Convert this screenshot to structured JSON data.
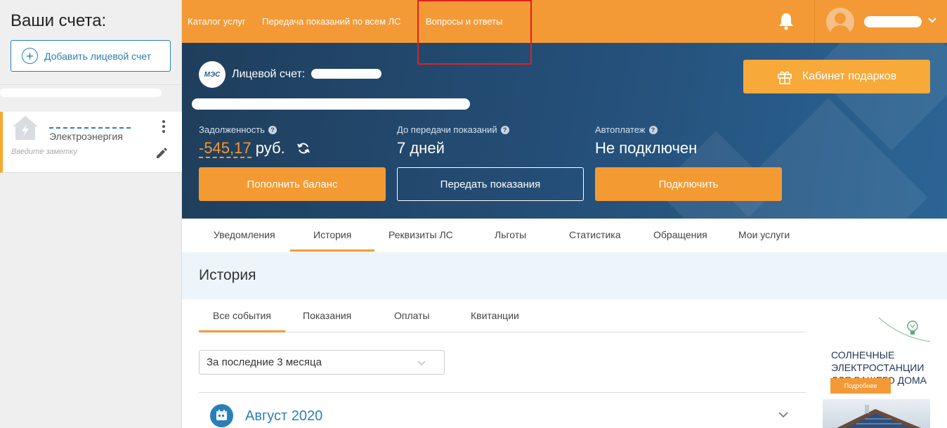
{
  "sidebar": {
    "title": "Ваши счета:",
    "add_account_label": "Добавить лицевой счет",
    "account": {
      "type": "Электроэнергия",
      "note_placeholder": "Введите заметку"
    }
  },
  "nav": {
    "links": [
      "Каталог услуг",
      "Передача показаний по всем ЛС",
      "Вопросы и ответы"
    ]
  },
  "hero": {
    "logo_text": "МЭС",
    "account_label": "Лицевой счет:",
    "gift_button": "Кабинет подарков",
    "debt": {
      "label": "Задолженность",
      "value": "-545,17",
      "unit": "руб."
    },
    "readings": {
      "label": "До передачи показаний",
      "value": "7 дней"
    },
    "autopay": {
      "label": "Автоплатеж",
      "value": "Не подключен"
    },
    "buttons": {
      "top_up": "Пополнить баланс",
      "submit_readings": "Передать показания",
      "connect": "Подключить"
    }
  },
  "tabs": [
    "Уведомления",
    "История",
    "Реквизиты ЛС",
    "Льготы",
    "Статистика",
    "Обращения",
    "Мои услуги"
  ],
  "history": {
    "title": "История",
    "subtabs": [
      "Все события",
      "Показания",
      "Оплаты",
      "Квитанции"
    ],
    "period": "За последние 3 месяца",
    "month": "Август 2020"
  },
  "ad": {
    "title": "СОЛНЕЧНЫЕ ЭЛЕКТРОСТАНЦИИ ДЛЯ ВАШЕГО ДОМА",
    "button": "Подробнее"
  },
  "colors": {
    "orange": "#f39a36",
    "navy": "#25507a",
    "blue_link": "#2a7fb8"
  }
}
